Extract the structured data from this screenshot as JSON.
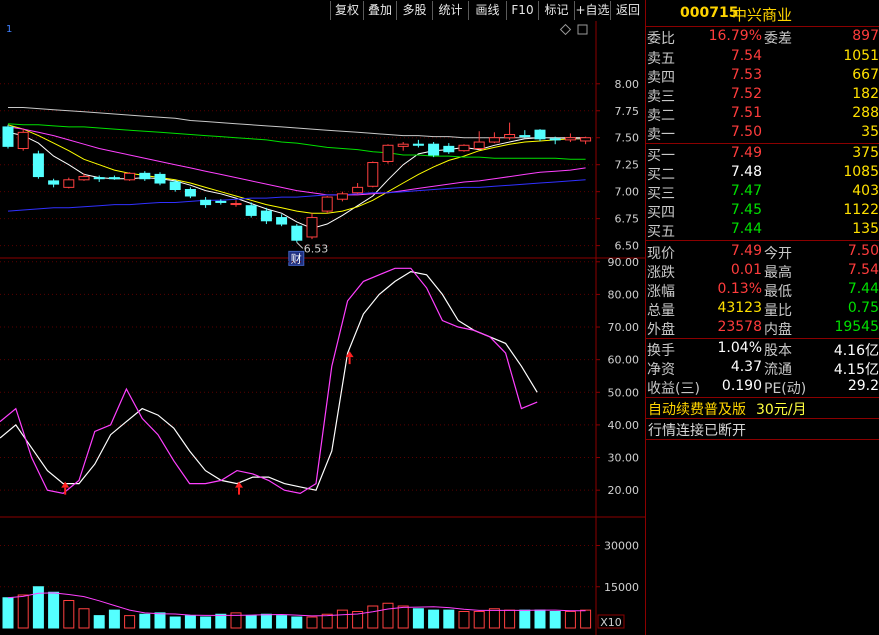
{
  "toolbar": {
    "buttons": [
      "复权",
      "叠加",
      "多股",
      "统计",
      "画线",
      "F10",
      "标记",
      "+自选",
      "返回"
    ]
  },
  "chart": {
    "corner_mark": "1",
    "diamond_icon": "diamond-icon",
    "square_icon": "square-icon",
    "price_axis_ticks": [
      "8.00",
      "7.75",
      "7.50",
      "7.25",
      "7.00",
      "6.75",
      "6.50"
    ],
    "low_marker": "6.53",
    "finance_marker": "财",
    "kdj_axis_ticks": [
      "90.00",
      "80.00",
      "70.00",
      "60.00",
      "50.00",
      "40.00",
      "30.00",
      "20.00"
    ],
    "volume_axis_ticks": [
      "30000",
      "15000"
    ],
    "volume_unit": "X10",
    "colors": {
      "up": "#ff4040",
      "down": "#54ffff",
      "grid": "#5a0000",
      "axis": "#8b0000"
    }
  },
  "chart_data": [
    {
      "type": "candlestick",
      "ylim": [
        6.45,
        8.1
      ],
      "candles": [
        {
          "o": 7.6,
          "h": 7.62,
          "l": 7.4,
          "c": 7.42
        },
        {
          "o": 7.4,
          "h": 7.58,
          "l": 7.38,
          "c": 7.55
        },
        {
          "o": 7.35,
          "h": 7.38,
          "l": 7.12,
          "c": 7.14
        },
        {
          "o": 7.1,
          "h": 7.12,
          "l": 7.04,
          "c": 7.07
        },
        {
          "o": 7.04,
          "h": 7.13,
          "l": 7.03,
          "c": 7.11
        },
        {
          "o": 7.11,
          "h": 7.17,
          "l": 7.1,
          "c": 7.14
        },
        {
          "o": 7.13,
          "h": 7.15,
          "l": 7.09,
          "c": 7.12
        },
        {
          "o": 7.13,
          "h": 7.15,
          "l": 7.11,
          "c": 7.12
        },
        {
          "o": 7.11,
          "h": 7.18,
          "l": 7.1,
          "c": 7.17
        },
        {
          "o": 7.17,
          "h": 7.19,
          "l": 7.1,
          "c": 7.12
        },
        {
          "o": 7.16,
          "h": 7.18,
          "l": 7.06,
          "c": 7.08
        },
        {
          "o": 7.09,
          "h": 7.11,
          "l": 7.0,
          "c": 7.02
        },
        {
          "o": 7.02,
          "h": 7.04,
          "l": 6.94,
          "c": 6.96
        },
        {
          "o": 6.92,
          "h": 6.95,
          "l": 6.85,
          "c": 6.88
        },
        {
          "o": 6.91,
          "h": 6.93,
          "l": 6.88,
          "c": 6.9
        },
        {
          "o": 6.89,
          "h": 6.92,
          "l": 6.86,
          "c": 6.89
        },
        {
          "o": 6.87,
          "h": 6.9,
          "l": 6.76,
          "c": 6.78
        },
        {
          "o": 6.82,
          "h": 6.85,
          "l": 6.7,
          "c": 6.73
        },
        {
          "o": 6.76,
          "h": 6.79,
          "l": 6.68,
          "c": 6.7
        },
        {
          "o": 6.68,
          "h": 6.7,
          "l": 6.53,
          "c": 6.55
        },
        {
          "o": 6.58,
          "h": 6.8,
          "l": 6.56,
          "c": 6.76
        },
        {
          "o": 6.82,
          "h": 6.96,
          "l": 6.8,
          "c": 6.95
        },
        {
          "o": 6.93,
          "h": 7.0,
          "l": 6.91,
          "c": 6.98
        },
        {
          "o": 6.99,
          "h": 7.08,
          "l": 6.98,
          "c": 7.04
        },
        {
          "o": 7.05,
          "h": 7.28,
          "l": 7.04,
          "c": 7.27
        },
        {
          "o": 7.28,
          "h": 7.44,
          "l": 7.26,
          "c": 7.43
        },
        {
          "o": 7.42,
          "h": 7.46,
          "l": 7.38,
          "c": 7.44
        },
        {
          "o": 7.44,
          "h": 7.48,
          "l": 7.41,
          "c": 7.43
        },
        {
          "o": 7.44,
          "h": 7.46,
          "l": 7.32,
          "c": 7.34
        },
        {
          "o": 7.42,
          "h": 7.45,
          "l": 7.35,
          "c": 7.37
        },
        {
          "o": 7.38,
          "h": 7.44,
          "l": 7.37,
          "c": 7.43
        },
        {
          "o": 7.4,
          "h": 7.56,
          "l": 7.39,
          "c": 7.46
        },
        {
          "o": 7.46,
          "h": 7.55,
          "l": 7.45,
          "c": 7.5
        },
        {
          "o": 7.5,
          "h": 7.64,
          "l": 7.48,
          "c": 7.53
        },
        {
          "o": 7.52,
          "h": 7.57,
          "l": 7.5,
          "c": 7.51
        },
        {
          "o": 7.57,
          "h": 7.58,
          "l": 7.47,
          "c": 7.49
        },
        {
          "o": 7.49,
          "h": 7.51,
          "l": 7.44,
          "c": 7.48
        },
        {
          "o": 7.48,
          "h": 7.54,
          "l": 7.46,
          "c": 7.5
        },
        {
          "o": 7.47,
          "h": 7.51,
          "l": 7.44,
          "c": 7.5
        }
      ],
      "moving_averages": [
        {
          "color": "#ffffff",
          "values": [
            7.55,
            7.52,
            7.45,
            7.33,
            7.25,
            7.16,
            7.13,
            7.12,
            7.12,
            7.13,
            7.12,
            7.1,
            7.06,
            7.01,
            6.98,
            6.94,
            6.89,
            6.84,
            6.8,
            6.72,
            6.66,
            6.7,
            6.78,
            6.87,
            6.96,
            7.11,
            7.25,
            7.35,
            7.38,
            7.39,
            7.41,
            7.39,
            7.43,
            7.46,
            7.49,
            7.5,
            7.5,
            7.5,
            7.5
          ]
        },
        {
          "color": "#ffff00",
          "values": [
            7.62,
            7.58,
            7.52,
            7.45,
            7.38,
            7.3,
            7.25,
            7.2,
            7.17,
            7.15,
            7.13,
            7.11,
            7.08,
            7.04,
            7.0,
            6.96,
            6.92,
            6.88,
            6.85,
            6.82,
            6.8,
            6.8,
            6.82,
            6.86,
            6.92,
            7.0,
            7.08,
            7.16,
            7.23,
            7.29,
            7.33,
            7.38,
            7.41,
            7.44,
            7.46,
            7.47,
            7.48,
            7.49,
            7.49
          ]
        },
        {
          "color": "#ff40ff",
          "values": [
            7.6,
            7.58,
            7.55,
            7.52,
            7.48,
            7.44,
            7.4,
            7.37,
            7.34,
            7.31,
            7.28,
            7.25,
            7.22,
            7.19,
            7.16,
            7.13,
            7.1,
            7.07,
            7.04,
            7.01,
            6.99,
            6.97,
            6.97,
            6.97,
            6.98,
            6.99,
            7.01,
            7.03,
            7.05,
            7.07,
            7.09,
            7.1,
            7.12,
            7.14,
            7.16,
            7.18,
            7.19,
            7.2,
            7.22
          ]
        },
        {
          "color": "#00e000",
          "values": [
            7.63,
            7.62,
            7.62,
            7.61,
            7.6,
            7.6,
            7.59,
            7.58,
            7.57,
            7.56,
            7.55,
            7.54,
            7.53,
            7.52,
            7.51,
            7.5,
            7.49,
            7.48,
            7.46,
            7.45,
            7.43,
            7.41,
            7.4,
            7.39,
            7.37,
            7.36,
            7.34,
            7.34,
            7.33,
            7.33,
            7.32,
            7.32,
            7.31,
            7.31,
            7.31,
            7.31,
            7.31,
            7.3,
            7.3
          ]
        },
        {
          "color": "#c8c8c8",
          "values": [
            7.78,
            7.78,
            7.77,
            7.76,
            7.75,
            7.74,
            7.73,
            7.72,
            7.71,
            7.7,
            7.69,
            7.68,
            7.66,
            7.65,
            7.64,
            7.63,
            7.62,
            7.61,
            7.6,
            7.59,
            7.58,
            7.57,
            7.56,
            7.55,
            7.54,
            7.53,
            7.52,
            7.52,
            7.51,
            7.51,
            7.5,
            7.5,
            7.5,
            7.5,
            7.5,
            7.5,
            7.5,
            7.49,
            7.49
          ]
        },
        {
          "color": "#3030ff",
          "values": [
            6.82,
            6.83,
            6.84,
            6.85,
            6.85,
            6.86,
            6.87,
            6.88,
            6.88,
            6.89,
            6.9,
            6.9,
            6.91,
            6.92,
            6.92,
            6.93,
            6.94,
            6.94,
            6.95,
            6.95,
            6.96,
            6.97,
            6.97,
            6.98,
            6.99,
            6.99,
            7.0,
            7.01,
            7.02,
            7.03,
            7.04,
            7.04,
            7.05,
            7.06,
            7.07,
            7.08,
            7.09,
            7.1,
            7.11
          ]
        }
      ]
    },
    {
      "type": "line",
      "ylim": [
        13,
        93
      ],
      "series": [
        {
          "color": "#ffffff",
          "values": [
            36,
            40,
            33,
            26,
            22,
            22,
            28,
            37,
            41,
            45,
            43,
            39,
            32,
            26,
            23,
            22,
            24,
            24,
            22,
            21,
            20,
            32,
            62,
            74,
            80,
            84,
            87,
            86,
            80,
            72,
            69,
            67,
            65,
            58,
            50
          ]
        },
        {
          "color": "#ff40ff",
          "values": [
            41,
            45,
            30,
            20,
            19,
            23,
            38,
            40,
            51,
            42,
            37,
            29,
            22,
            22,
            23,
            26,
            25,
            23,
            20,
            19,
            22,
            58,
            78,
            84,
            86,
            88,
            88,
            82,
            72,
            70,
            69,
            67,
            62,
            45,
            47
          ]
        }
      ],
      "signals": [
        4,
        15,
        22
      ]
    },
    {
      "type": "bar",
      "ylim": [
        0,
        40000
      ],
      "values": [
        11000,
        12000,
        15000,
        13000,
        10000,
        7000,
        4500,
        6500,
        4500,
        5000,
        5500,
        4000,
        4500,
        4000,
        5000,
        5500,
        4500,
        5000,
        4500,
        4000,
        4000,
        5000,
        6500,
        6000,
        8000,
        9000,
        8000,
        7000,
        6500,
        6500,
        6000,
        6000,
        7000,
        6500,
        6500,
        6500,
        6000,
        6000,
        6500
      ]
    }
  ],
  "quote": {
    "code": "000715",
    "name": "中兴商业",
    "rows": [
      {
        "label": "委比",
        "value": "16.79%",
        "label2": "委差",
        "value2": "897",
        "c1": "red",
        "c2": "red"
      },
      {
        "label": "卖五",
        "value": "7.54",
        "value2": "1051",
        "c1": "red",
        "c2": "yel"
      },
      {
        "label": "卖四",
        "value": "7.53",
        "value2": "667",
        "c1": "red",
        "c2": "yel"
      },
      {
        "label": "卖三",
        "value": "7.52",
        "value2": "182",
        "c1": "red",
        "c2": "yel"
      },
      {
        "label": "卖二",
        "value": "7.51",
        "value2": "288",
        "c1": "red",
        "c2": "yel"
      },
      {
        "label": "卖一",
        "value": "7.50",
        "value2": "35",
        "c1": "red",
        "c2": "yel"
      },
      {
        "label": "买一",
        "value": "7.49",
        "value2": "375",
        "c1": "red",
        "c2": "yel"
      },
      {
        "label": "买二",
        "value": "7.48",
        "value2": "1085",
        "c1": "wht",
        "c2": "yel"
      },
      {
        "label": "买三",
        "value": "7.47",
        "value2": "403",
        "c1": "grn",
        "c2": "yel"
      },
      {
        "label": "买四",
        "value": "7.45",
        "value2": "1122",
        "c1": "grn",
        "c2": "yel"
      },
      {
        "label": "买五",
        "value": "7.44",
        "value2": "135",
        "c1": "grn",
        "c2": "yel"
      },
      {
        "label": "现价",
        "value": "7.49",
        "label2": "今开",
        "value2": "7.50",
        "c1": "red",
        "c2": "red"
      },
      {
        "label": "涨跌",
        "value": "0.01",
        "label2": "最高",
        "value2": "7.54",
        "c1": "red",
        "c2": "red"
      },
      {
        "label": "涨幅",
        "value": "0.13%",
        "label2": "最低",
        "value2": "7.44",
        "c1": "red",
        "c2": "grn"
      },
      {
        "label": "总量",
        "value": "43123",
        "label2": "量比",
        "value2": "0.75",
        "c1": "yel",
        "c2": "grn"
      },
      {
        "label": "外盘",
        "value": "23578",
        "label2": "内盘",
        "value2": "19545",
        "c1": "red",
        "c2": "grn"
      },
      {
        "label": "换手",
        "value": "1.04%",
        "label2": "股本",
        "value2": "4.16亿",
        "c1": "wht",
        "c2": "wht"
      },
      {
        "label": "净资",
        "value": "4.37",
        "label2": "流通",
        "value2": "4.15亿",
        "c1": "wht",
        "c2": "wht"
      },
      {
        "label": "收益(三)",
        "value": "0.190",
        "label2": "PE(动)",
        "value2": "29.2",
        "c1": "wht",
        "c2": "wht"
      }
    ],
    "promo": "自动续费普及版",
    "promo_price": "30元/月",
    "status": "行情连接已断开"
  }
}
